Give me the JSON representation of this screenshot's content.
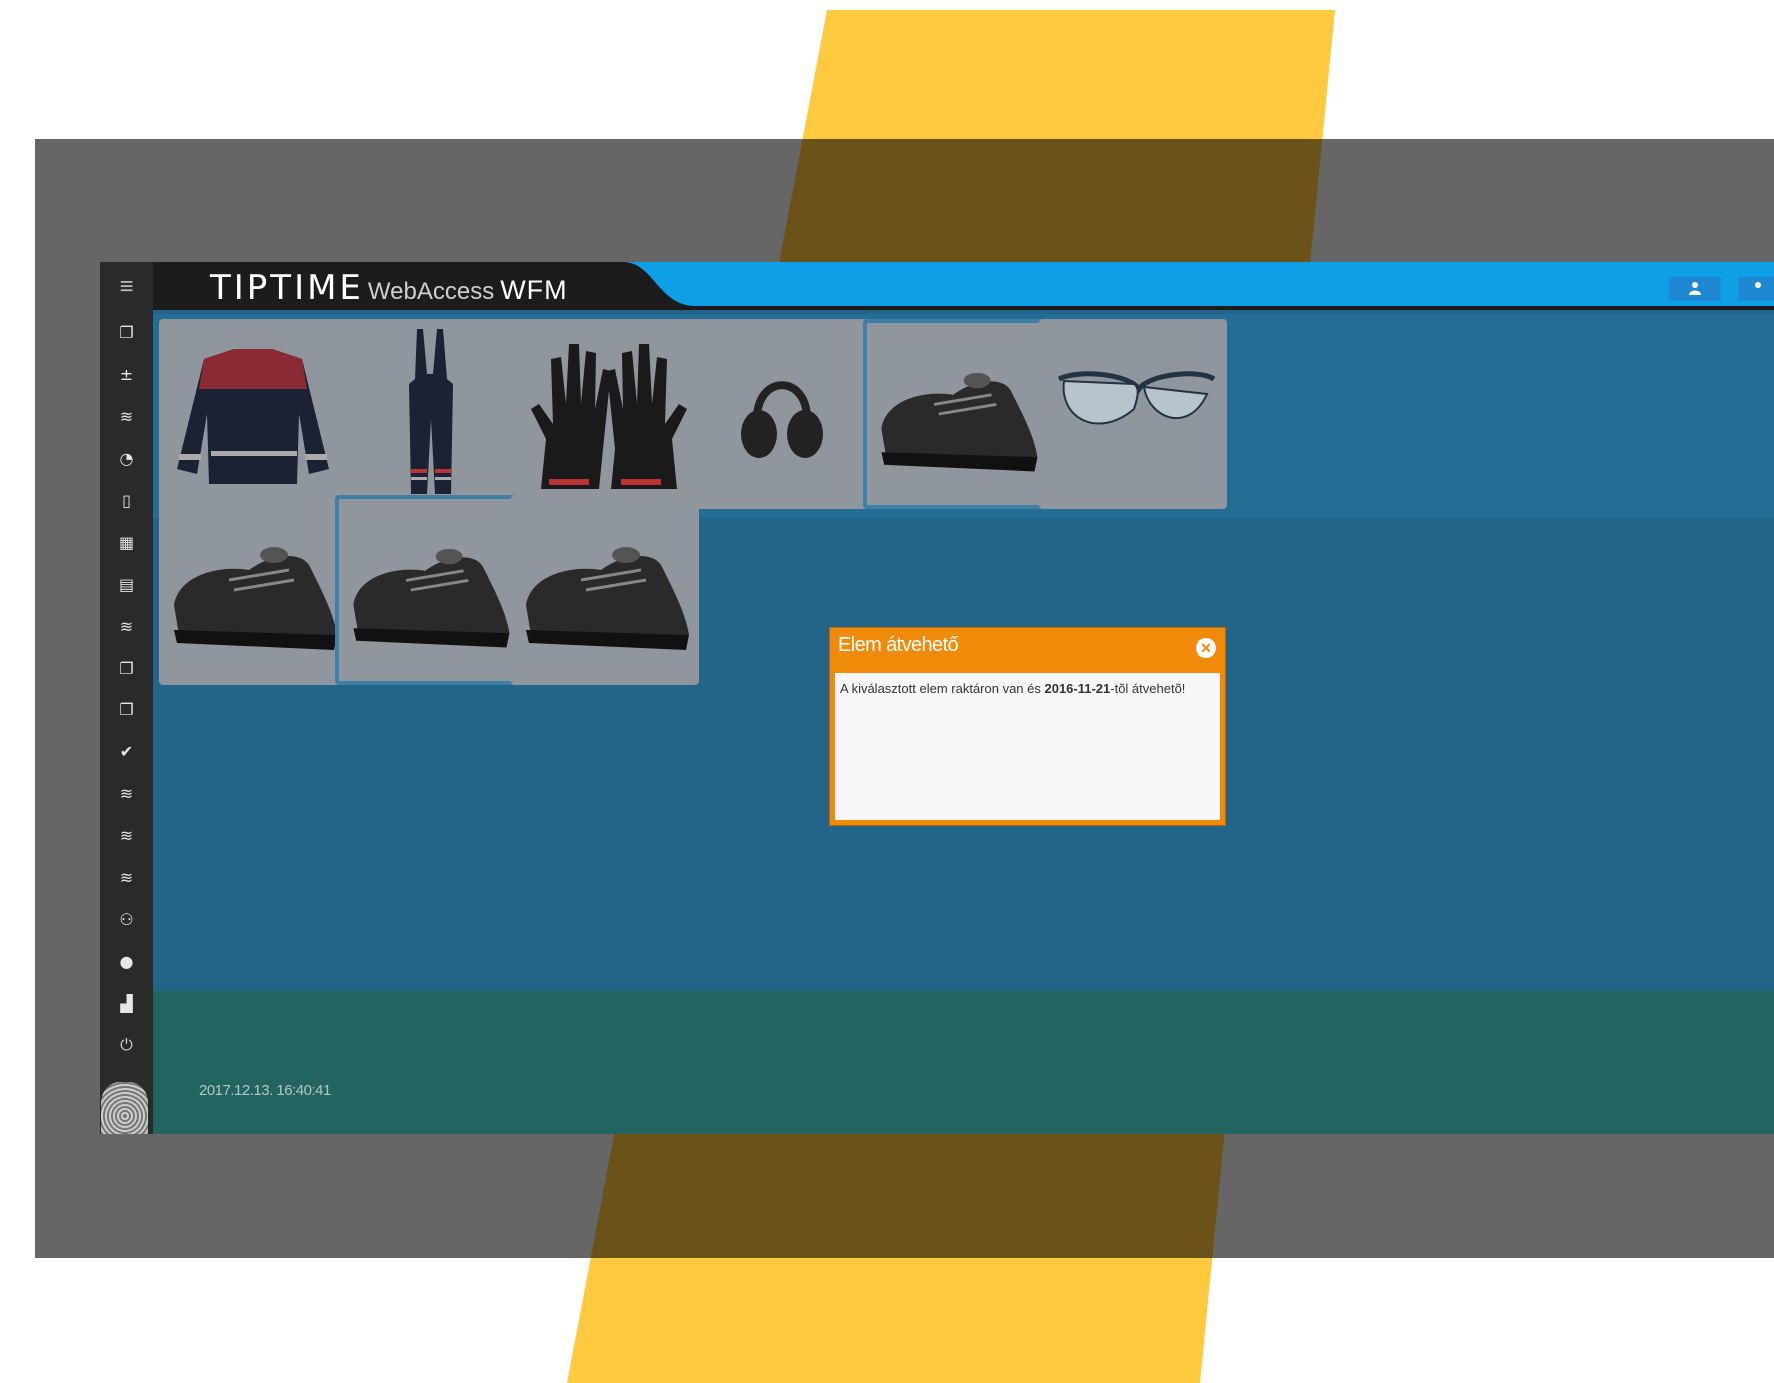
{
  "colors": {
    "accent_yellow": "#ffc940",
    "accent_yellow_dim": "#6a5219",
    "frame_grey": "#666666",
    "app_blue": "#23648a",
    "header_blue": "#0ea0e6",
    "footer_teal": "#22645f",
    "dialog_orange": "#f08a09"
  },
  "header": {
    "brand_main": "TIPTIME",
    "brand_sub": "WebAccess",
    "brand_suffix": "WFM",
    "buttons": [
      {
        "icon": "user-icon"
      },
      {
        "icon": "user-icon"
      }
    ]
  },
  "sidebar": {
    "menu_icon": "≡",
    "items": [
      {
        "icon": "documents-icon",
        "glyph": "❐"
      },
      {
        "icon": "plus-minus-icon",
        "glyph": "±"
      },
      {
        "icon": "database-icon",
        "glyph": "≋"
      },
      {
        "icon": "pie-chart-icon",
        "glyph": "◔"
      },
      {
        "icon": "file-icon",
        "glyph": "▯"
      },
      {
        "icon": "calendar-24-icon",
        "glyph": "▦"
      },
      {
        "icon": "calendar-icon",
        "glyph": "▤"
      },
      {
        "icon": "database-icon",
        "glyph": "≋"
      },
      {
        "icon": "documents-icon",
        "glyph": "❐"
      },
      {
        "icon": "documents-icon",
        "glyph": "❐"
      },
      {
        "icon": "check-icon",
        "glyph": "✔"
      },
      {
        "icon": "database-icon",
        "glyph": "≋"
      },
      {
        "icon": "database-icon",
        "glyph": "≋"
      },
      {
        "icon": "database-icon",
        "glyph": "≋"
      },
      {
        "icon": "users-icon",
        "glyph": "⚇"
      },
      {
        "icon": "user-icon",
        "glyph": "●"
      },
      {
        "icon": "bar-chart-icon",
        "glyph": "▟"
      },
      {
        "icon": "power-icon",
        "glyph": "⏻"
      }
    ]
  },
  "tiles": [
    {
      "name": "tile-work-jacket",
      "item": "jacket",
      "selected": false
    },
    {
      "name": "tile-bib-trousers",
      "item": "overalls",
      "selected": false
    },
    {
      "name": "tile-gloves",
      "item": "gloves",
      "selected": false
    },
    {
      "name": "tile-ear-muffs",
      "item": "earmuffs",
      "selected": false
    },
    {
      "name": "tile-safety-shoe-1",
      "item": "shoe",
      "selected": true
    },
    {
      "name": "tile-safety-glasses",
      "item": "glasses",
      "selected": false
    },
    {
      "name": "tile-safety-shoe-2",
      "item": "shoe",
      "selected": false
    },
    {
      "name": "tile-safety-shoe-3",
      "item": "shoe",
      "selected": true
    },
    {
      "name": "tile-safety-shoe-4",
      "item": "shoe",
      "selected": false
    }
  ],
  "footer": {
    "timestamp": "2017.12.13. 16:40:41"
  },
  "dialog": {
    "title": "Elem átvehető",
    "close_glyph": "✕",
    "body_prefix": "A kiválasztott elem raktáron van és ",
    "body_date": "2016-11-21",
    "body_suffix": "-tõl átvehetõ!"
  }
}
